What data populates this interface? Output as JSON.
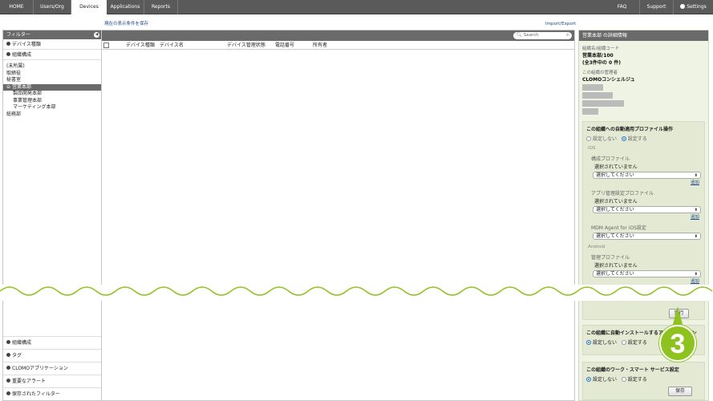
{
  "nav": {
    "tabs": [
      "HOME",
      "Users/Org",
      "Devices",
      "Applications",
      "Reports"
    ],
    "active_tab": "Devices",
    "right": [
      "FAQ",
      "Support",
      "Settings"
    ]
  },
  "toolbar": {
    "save_condition": "現在の表示条件を保存",
    "import_export": "Import/Export"
  },
  "sidebar": {
    "title": "フィルター",
    "sections_top": [
      "デバイス種類",
      "組織構成"
    ],
    "org_items": [
      "(未所属)",
      "取締役",
      "秘書室",
      "営業本部",
      "製品開発本部",
      "事業管理本部",
      "マーケティング本部",
      "総務部"
    ],
    "selected_org": "営業本部",
    "sections_bottom": [
      "組織構成",
      "タグ",
      "CLOMOアプリケーション",
      "重要なアラート",
      "保存されたフィルター"
    ]
  },
  "grid": {
    "search_placeholder": "Search",
    "columns": [
      "デバイス種類",
      "デバイス名",
      "デバイス管理状態",
      "電話番号",
      "所有者"
    ]
  },
  "detail": {
    "title": "営業本部 の詳細情報",
    "org_label": "組織名/組織コード",
    "org_value": "営業本部/100",
    "org_count": "(全3件中の 0 件)",
    "admin_label": "この組織の管理者",
    "admin_value": "CLOMOコンシェルジュ",
    "profile_box": {
      "title": "この組織への自動適用プロファイル操作",
      "opt_off": "設定しない",
      "opt_on": "設定する",
      "ios": "iOS",
      "config_profile": "構成プロファイル",
      "not_selected": "選択されていません",
      "select_placeholder": "選択してください",
      "add": "追加",
      "app_profile": "アプリ管理設定プロファイル",
      "not_selected2": "選択されていません",
      "add2": "追加",
      "mdm_agent": "MDM Agent for iOS設定",
      "android": "Android",
      "mgmt_profile": "管理プロファイル",
      "not_selected3": "選択されていません",
      "add3": "追加",
      "run": "実行"
    },
    "app_box": {
      "title": "この組織に自動インストールするアプリケーション",
      "opt_off": "設定しない",
      "opt_on": "設定する"
    },
    "work_box": {
      "title": "この組織のワーク・スマート サービス設定",
      "opt_off": "設定しない",
      "opt_on": "設定する",
      "save": "保存"
    }
  },
  "callout": {
    "number": "3",
    "color": "#8dc21f"
  }
}
